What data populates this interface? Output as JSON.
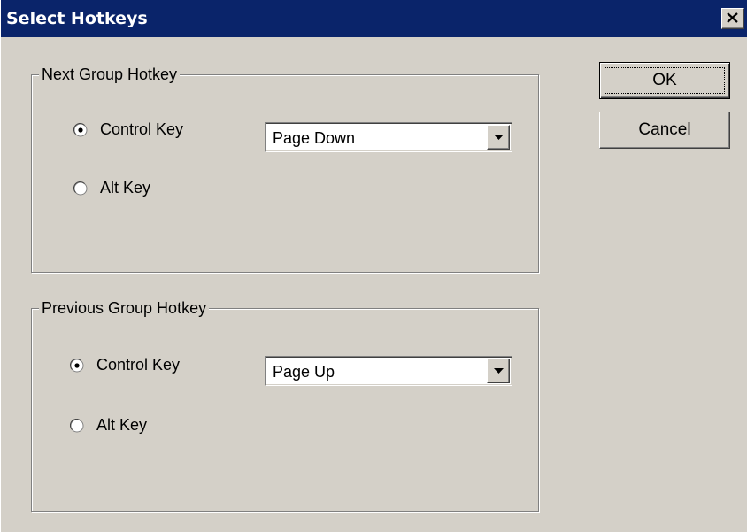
{
  "window": {
    "title": "Select Hotkeys"
  },
  "next_group": {
    "label": "Next Group Hotkey",
    "control_label": "Control Key",
    "alt_label": "Alt Key",
    "selected": "control",
    "combo_value": "Page Down"
  },
  "prev_group": {
    "label": "Previous Group Hotkey",
    "control_label": "Control Key",
    "alt_label": "Alt Key",
    "selected": "control",
    "combo_value": "Page Up"
  },
  "buttons": {
    "ok_label": "OK",
    "cancel_label": "Cancel"
  },
  "icons": {
    "close": "close-icon",
    "dropdown": "chevron-down-icon",
    "radio_checked": "radio-checked-icon",
    "radio_unchecked": "radio-unchecked-icon"
  },
  "colors": {
    "titlebar": "#0a246a",
    "face": "#d4d0c8"
  }
}
